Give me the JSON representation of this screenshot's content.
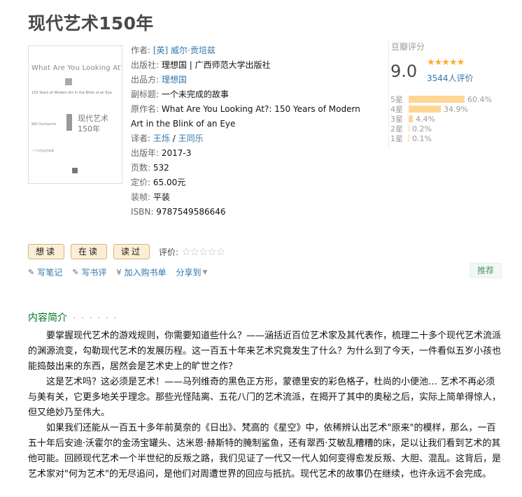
{
  "book": {
    "title": "现代艺术150年"
  },
  "cover": {
    "en_title": "What Are You Looking At?",
    "en_sub": "150 Years of Modern Art in the Blink of an Eye",
    "cn_title": "现代艺术",
    "cn_title2": "150年",
    "author_short": "Will Gompertz",
    "tagline": "一个未完成的故事"
  },
  "info": {
    "author_label": "作者:",
    "author": "[英] 威尔·贡培兹",
    "publisher_label": "出版社:",
    "publisher": "理想国 | 广西师范大学出版社",
    "producer_label": "出品方:",
    "producer": "理想国",
    "subtitle_label": "副标题:",
    "subtitle": "一个未完成的故事",
    "original_label": "原作名:",
    "original_line1": "What Are You Looking At?: 150 Years of Modern",
    "original_line2": "Art in the Blink of an Eye",
    "translator_label": "译者:",
    "translator1": "王烁",
    "translator_sep": "/",
    "translator2": "王同乐",
    "year_label": "出版年:",
    "year": "2017-3",
    "pages_label": "页数:",
    "pages": "532",
    "price_label": "定价:",
    "price": "65.00元",
    "binding_label": "装帧:",
    "binding": "平装",
    "isbn_label": "ISBN:",
    "isbn": "9787549586646"
  },
  "rating": {
    "label": "豆瓣评分",
    "score": "9.0",
    "stars": "★★★★★",
    "count": "3544人评价",
    "star_level": 0.9,
    "histogram": [
      {
        "label": "5星",
        "pct": "60.4%",
        "value": 60.4
      },
      {
        "label": "4星",
        "pct": "34.9%",
        "value": 34.9
      },
      {
        "label": "3星",
        "pct": "4.4%",
        "value": 4.4
      },
      {
        "label": "2星",
        "pct": "0.2%",
        "value": 0.2
      },
      {
        "label": "1星",
        "pct": "0.1%",
        "value": 0.1
      }
    ]
  },
  "buttons": {
    "want": "想读",
    "reading": "在读",
    "read": "读过",
    "my_rating": "评价:",
    "empty_stars": "☆☆☆☆☆"
  },
  "actions": {
    "write_note": "写笔记",
    "write_review": "写书评",
    "add_cart": "加入购书单",
    "share": "分享到",
    "recommend": "推荐"
  },
  "intro": {
    "title": "内容简介",
    "dots": "· · · · · ·",
    "paragraphs": [
      "要掌握现代艺术的游戏规则，你需要知道些什么？——涵括近百位艺术家及其代表作，梳理二十多个现代艺术流派的渊源流变，勾勒现代艺术的发展历程。这一百五十年来艺术究竟发生了什么？为什么到了今天，一件看似五岁小孩也能捣鼓出来的东西，居然会是艺术史上的旷世之作？",
      "这是艺术吗？这必须是艺术！——马列维奇的黑色正方形，蒙德里安的彩色格子，杜尚的小便池…  艺术不再必须与美有关，它更多地关乎理念。那些光怪陆离、五花八门的艺术流派，在揭开了其中的奥秘之后，实际上简单得惊人，但又绝妙乃至伟大。",
      "如果我们还能从一百五十多年前莫奈的《日出》、梵高的《星空》中，依稀辨认出艺术\"原来\"的模样，那么，一百五十年后安迪·沃霍尔的金汤宝罐头、达米恩·赫斯特的腌制鲨鱼，还有翠西·艾敏乱糟糟的床，足以让我们看到艺术的其他可能。回顾现代艺术一个半世纪的反叛之路，我们见证了一代又一代人如何变得愈发反叛、大胆、混乱。这背后，是艺术家对\"何为艺术\"的无尽追问，是他们对周遭世界的回应与抵抗。现代艺术的故事仍在继续，也许永远不会完成。"
    ]
  }
}
